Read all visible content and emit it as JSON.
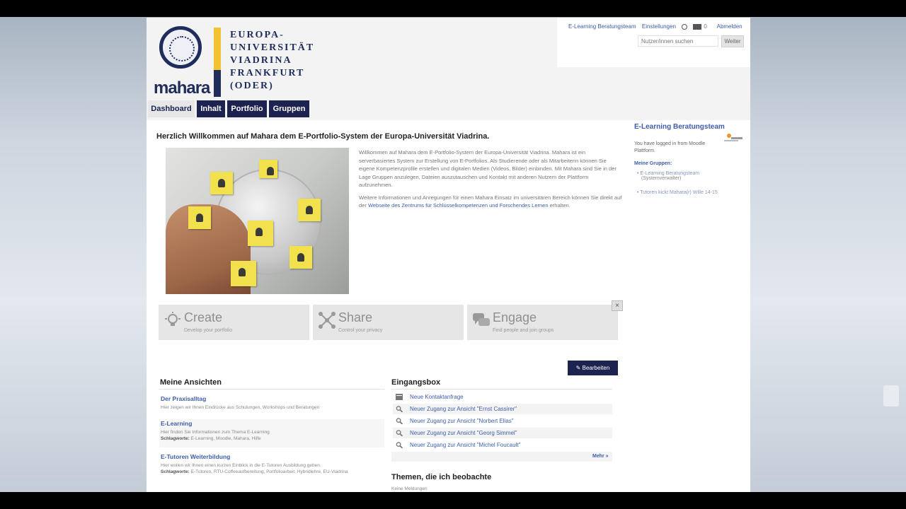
{
  "logo": {
    "brand": "mahara",
    "university_lines": [
      "EUROPA-",
      "UNIVERSITÄT",
      "VIADRINA",
      "FRANKFURT",
      "(ODER)"
    ]
  },
  "topbar": {
    "user": "E-Learning Beratungsteam",
    "settings": "Einstellungen",
    "inbox_count": "0",
    "logout": "Abmelden",
    "search_placeholder": "Nutzer/innen suchen",
    "search_button": "Weiter"
  },
  "nav": [
    "Dashboard",
    "Inhalt",
    "Portfolio",
    "Gruppen"
  ],
  "welcome": {
    "title": "Herzlich Willkommen auf Mahara dem E-Portfolio-System der Europa-Universität Viadrina.",
    "p1": "Willkommen auf Mahara dem E-Portfolio-System der Europa-Universität Viadrina. Mahara ist ein serverbasiertes System zur Erstellung von E-Portfolios. Als Studierende oder als Mitarbeiterin können Sie eigene Kompetenzprofile erstellen und digitalen Medien (Videos, Bilder) einbinden. Mit Mahara sind Sie in der Lage Gruppen anzulegen, Dateien auszutauschen und Kontakt mit anderen Nutzern der Plattform aufzunehmen.",
    "p2_before": "Weitere Informationen und Anregungen für einen Mahara Einsatz im universitären Bereich können Sie direkt auf der ",
    "p2_link": "Webseite des Zentrums für Schlüsselkompetenzen und Forschendes Lernen",
    "p2_after": " erhalten."
  },
  "features": [
    {
      "title": "Create",
      "subtitle": "Develop your portfolio"
    },
    {
      "title": "Share",
      "subtitle": "Control your privacy"
    },
    {
      "title": "Engage",
      "subtitle": "Find people and join groups"
    }
  ],
  "edit_button": "Bearbeiten",
  "views": {
    "title": "Meine Ansichten",
    "items": [
      {
        "title": "Der Praxisalltag",
        "desc": "Hier zeigen wir Ihnen Eindrücke aus Schulungen, Workshops und Beratungen",
        "tags_label": "",
        "tags": ""
      },
      {
        "title": "E-Learning",
        "desc": "Hier finden Sie Informationen zum Thema E-Learning",
        "tags_label": "Schlagworte:",
        "tags": "E-Learning, Moodle, Mahara, Hilfe"
      },
      {
        "title": "E-Tutoren Weiterbildung",
        "desc": "Hier wollen wir Ihnen einen kurzen Einblick in die E-Tutoren Ausbildung geben.",
        "tags_label": "Schlagworte:",
        "tags": "E-Tutoren, RTU-Coffeeaufbereitung, Portfolioarbeit, Hybridlehre, EU-Viadrina"
      }
    ]
  },
  "inbox": {
    "title": "Eingangsbox",
    "items": [
      "Neue Kontaktanfrage",
      "Neuer Zugang zur Ansicht \"Ernst Cassirer\"",
      "Neuer Zugang zur Ansicht \"Norbert Elias\"",
      "Neuer Zugang zur Ansicht \"Georg Simmel\"",
      "Neuer Zugang zur Ansicht \"Michel Foucault\""
    ],
    "more": "Mehr »"
  },
  "watched": {
    "title": "Themen, die ich beobachte",
    "note": "Keine Meldungen"
  },
  "sidebar": {
    "title": "E-Learning Beratungsteam",
    "logged_in": "You have logged in from Moodle Plattform.",
    "groups_label": "Meine Gruppen:",
    "groups": [
      {
        "name": "E-Learning Beratungsteam",
        "role": "(Systemverwalter)"
      },
      {
        "name": "Tutoren kickt Mahara(r) Wille 14-15",
        "role": ""
      }
    ]
  }
}
